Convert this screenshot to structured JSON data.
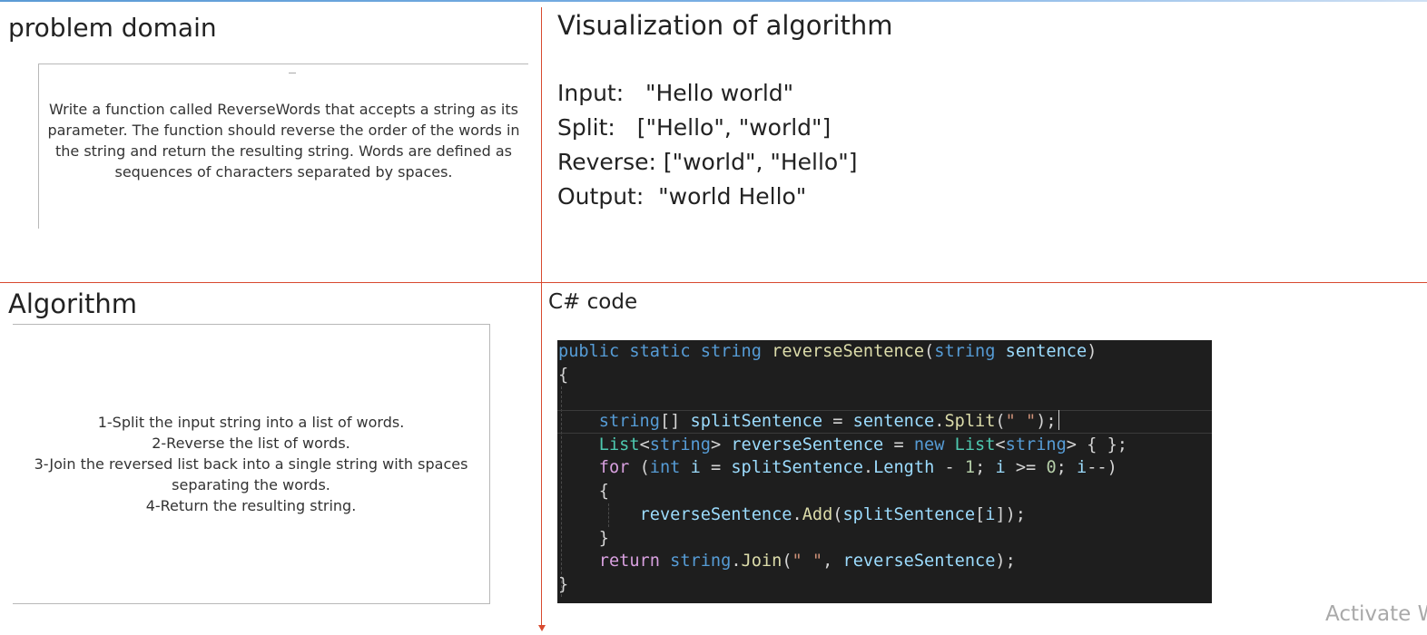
{
  "sections": {
    "problem_domain": "problem domain",
    "visualization": "Visualization of algorithm",
    "algorithm": "Algorithm",
    "code": "C# code"
  },
  "problem": {
    "text": "Write a function called ReverseWords that accepts a string as its parameter. The function should reverse the order of the words in the string and return the resulting string. Words are defined as sequences of characters separated by spaces."
  },
  "visualization": {
    "rows": [
      "Input:   \"Hello world\"",
      "Split:   [\"Hello\", \"world\"]",
      "Reverse: [\"world\", \"Hello\"]",
      "Output:  \"world Hello\""
    ]
  },
  "algorithm": {
    "steps": [
      "1-Split the input string into a list of words.",
      "2-Reverse the list of words.",
      "3-Join the reversed list back into a single string with spaces separating the words.",
      "4-Return the resulting string."
    ]
  },
  "code": {
    "lines": [
      [
        [
          "kw",
          "public"
        ],
        [
          "pl",
          " "
        ],
        [
          "kw",
          "static"
        ],
        [
          "pl",
          " "
        ],
        [
          "kw",
          "string"
        ],
        [
          "pl",
          " "
        ],
        [
          "fn",
          "reverseSentence"
        ],
        [
          "pl",
          "("
        ],
        [
          "kw",
          "string"
        ],
        [
          "pl",
          " "
        ],
        [
          "id",
          "sentence"
        ],
        [
          "pl",
          ")"
        ]
      ],
      [
        [
          "pl",
          "{"
        ]
      ],
      [],
      [
        [
          "pl",
          "    "
        ],
        [
          "kw",
          "string"
        ],
        [
          "pl",
          "[] "
        ],
        [
          "id",
          "splitSentence"
        ],
        [
          "pl",
          " = "
        ],
        [
          "id",
          "sentence"
        ],
        [
          "pl",
          "."
        ],
        [
          "fn",
          "Split"
        ],
        [
          "pl",
          "("
        ],
        [
          "st",
          "\" \""
        ],
        [
          "pl",
          ");"
        ]
      ],
      [
        [
          "pl",
          "    "
        ],
        [
          "ty",
          "List"
        ],
        [
          "pl",
          "<"
        ],
        [
          "kw",
          "string"
        ],
        [
          "pl",
          "> "
        ],
        [
          "id",
          "reverseSentence"
        ],
        [
          "pl",
          " = "
        ],
        [
          "kw",
          "new"
        ],
        [
          "pl",
          " "
        ],
        [
          "ty",
          "List"
        ],
        [
          "pl",
          "<"
        ],
        [
          "kw",
          "string"
        ],
        [
          "pl",
          "> { };"
        ]
      ],
      [
        [
          "pl",
          "    "
        ],
        [
          "ctl",
          "for"
        ],
        [
          "pl",
          " ("
        ],
        [
          "kw",
          "int"
        ],
        [
          "pl",
          " "
        ],
        [
          "id",
          "i"
        ],
        [
          "pl",
          " = "
        ],
        [
          "id",
          "splitSentence"
        ],
        [
          "pl",
          "."
        ],
        [
          "id",
          "Length"
        ],
        [
          "pl",
          " - "
        ],
        [
          "num",
          "1"
        ],
        [
          "pl",
          "; "
        ],
        [
          "id",
          "i"
        ],
        [
          "pl",
          " >= "
        ],
        [
          "num",
          "0"
        ],
        [
          "pl",
          "; "
        ],
        [
          "id",
          "i"
        ],
        [
          "pl",
          "--)"
        ]
      ],
      [
        [
          "pl",
          "    {"
        ]
      ],
      [
        [
          "pl",
          "        "
        ],
        [
          "id",
          "reverseSentence"
        ],
        [
          "pl",
          "."
        ],
        [
          "fn",
          "Add"
        ],
        [
          "pl",
          "("
        ],
        [
          "id",
          "splitSentence"
        ],
        [
          "pl",
          "["
        ],
        [
          "id",
          "i"
        ],
        [
          "pl",
          "]);"
        ]
      ],
      [
        [
          "pl",
          "    }"
        ]
      ],
      [
        [
          "pl",
          "    "
        ],
        [
          "ctl",
          "return"
        ],
        [
          "pl",
          " "
        ],
        [
          "kw",
          "string"
        ],
        [
          "pl",
          "."
        ],
        [
          "fn",
          "Join"
        ],
        [
          "pl",
          "("
        ],
        [
          "st",
          "\" \""
        ],
        [
          "pl",
          ", "
        ],
        [
          "id",
          "reverseSentence"
        ],
        [
          "pl",
          ");"
        ]
      ],
      [
        [
          "pl",
          "}"
        ]
      ]
    ],
    "current_line": 3
  },
  "watermark": "Activate W"
}
